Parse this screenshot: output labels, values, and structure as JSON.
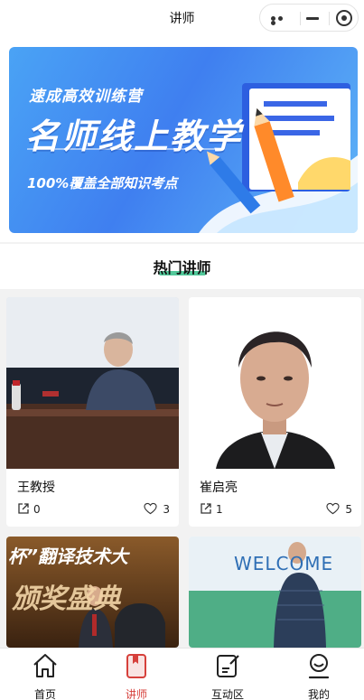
{
  "window": {
    "title": "讲师"
  },
  "banner": {
    "line1": "速成高效训练营",
    "line2": "名师线上教学",
    "line3": "100%覆盖全部知识考点"
  },
  "section": {
    "title": "热门讲师"
  },
  "teachers": [
    {
      "name": "王教授",
      "shares": "0",
      "likes": "3"
    },
    {
      "name": "崔启亮",
      "shares": "1",
      "likes": "5"
    },
    {
      "photo_text": "杯”翻译技术大",
      "photo_subtext": "颁奖盛典"
    },
    {
      "photo_text": "WELCOME"
    }
  ],
  "tabbar": {
    "items": [
      {
        "label": "首页",
        "icon": "home-icon"
      },
      {
        "label": "讲师",
        "icon": "bookmark-book-icon"
      },
      {
        "label": "互动区",
        "icon": "edit-note-icon"
      },
      {
        "label": "我的",
        "icon": "person-icon"
      }
    ],
    "active_index": 1,
    "active_color": "#d6403b"
  }
}
